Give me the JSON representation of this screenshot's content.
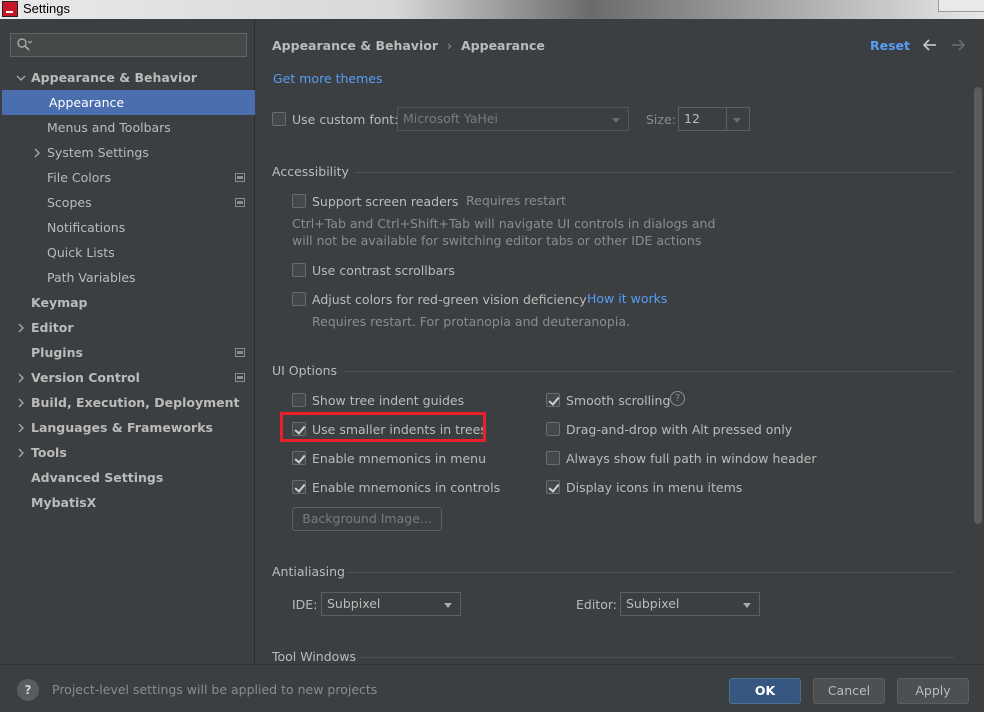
{
  "window": {
    "title": "Settings"
  },
  "sidebar": {
    "search_placeholder": "",
    "items": [
      {
        "label": "Appearance & Behavior",
        "level": 0,
        "expanded": true,
        "bold": true
      },
      {
        "label": "Appearance",
        "level": 1,
        "selected": true
      },
      {
        "label": "Menus and Toolbars",
        "level": 1
      },
      {
        "label": "System Settings",
        "level": 1,
        "collapsible": true
      },
      {
        "label": "File Colors",
        "level": 1,
        "project": true
      },
      {
        "label": "Scopes",
        "level": 1,
        "project": true
      },
      {
        "label": "Notifications",
        "level": 1
      },
      {
        "label": "Quick Lists",
        "level": 1
      },
      {
        "label": "Path Variables",
        "level": 1
      },
      {
        "label": "Keymap",
        "level": 0,
        "bold": true
      },
      {
        "label": "Editor",
        "level": 0,
        "collapsible": true,
        "bold": true
      },
      {
        "label": "Plugins",
        "level": 0,
        "bold": true,
        "project": true
      },
      {
        "label": "Version Control",
        "level": 0,
        "collapsible": true,
        "bold": true,
        "project": true
      },
      {
        "label": "Build, Execution, Deployment",
        "level": 0,
        "collapsible": true,
        "bold": true
      },
      {
        "label": "Languages & Frameworks",
        "level": 0,
        "collapsible": true,
        "bold": true
      },
      {
        "label": "Tools",
        "level": 0,
        "collapsible": true,
        "bold": true
      },
      {
        "label": "Advanced Settings",
        "level": 0,
        "bold": true
      },
      {
        "label": "MybatisX",
        "level": 0,
        "bold": true
      }
    ]
  },
  "header": {
    "breadcrumb": [
      "Appearance & Behavior",
      "Appearance"
    ],
    "reset_label": "Reset"
  },
  "main": {
    "get_more_themes": "Get more themes",
    "custom_font": {
      "label": "Use custom font:",
      "checked": false,
      "font_value": "Microsoft YaHei",
      "size_label": "Size:",
      "size_value": "12"
    },
    "accessibility": {
      "title": "Accessibility",
      "screen_readers": {
        "label": "Support screen readers",
        "note": "Requires restart",
        "checked": false
      },
      "screen_readers_desc_1": "Ctrl+Tab and Ctrl+Shift+Tab will navigate UI controls in dialogs and",
      "screen_readers_desc_2": "will not be available for switching editor tabs or other IDE actions",
      "contrast_scrollbars": {
        "label": "Use contrast scrollbars",
        "checked": false
      },
      "red_green": {
        "label": "Adjust colors for red-green vision deficiency",
        "link": "How it works",
        "checked": false
      },
      "red_green_note": "Requires restart. For protanopia and deuteranopia."
    },
    "ui_options": {
      "title": "UI Options",
      "left": [
        {
          "label": "Show tree indent guides",
          "checked": false
        },
        {
          "label": "Use smaller indents in trees",
          "checked": true
        },
        {
          "label": "Enable mnemonics in menu",
          "checked": true
        },
        {
          "label": "Enable mnemonics in controls",
          "checked": true
        }
      ],
      "right": [
        {
          "label": "Smooth scrolling",
          "checked": true
        },
        {
          "label": "Drag-and-drop with Alt pressed only",
          "checked": false
        },
        {
          "label": "Always show full path in window header",
          "checked": false
        },
        {
          "label": "Display icons in menu items",
          "checked": true
        }
      ],
      "background_image_label": "Background Image..."
    },
    "antialiasing": {
      "title": "Antialiasing",
      "ide_label": "IDE:",
      "ide_value": "Subpixel",
      "editor_label": "Editor:",
      "editor_value": "Subpixel"
    },
    "tool_windows": {
      "title": "Tool Windows"
    }
  },
  "footer": {
    "note": "Project-level settings will be applied to new projects",
    "ok_label": "OK",
    "cancel_label": "Cancel",
    "apply_label": "Apply"
  },
  "colors": {
    "accent": "#4b6eaf",
    "link": "#589df6",
    "highlight": "#e8202a",
    "background": "#3c3f41"
  }
}
